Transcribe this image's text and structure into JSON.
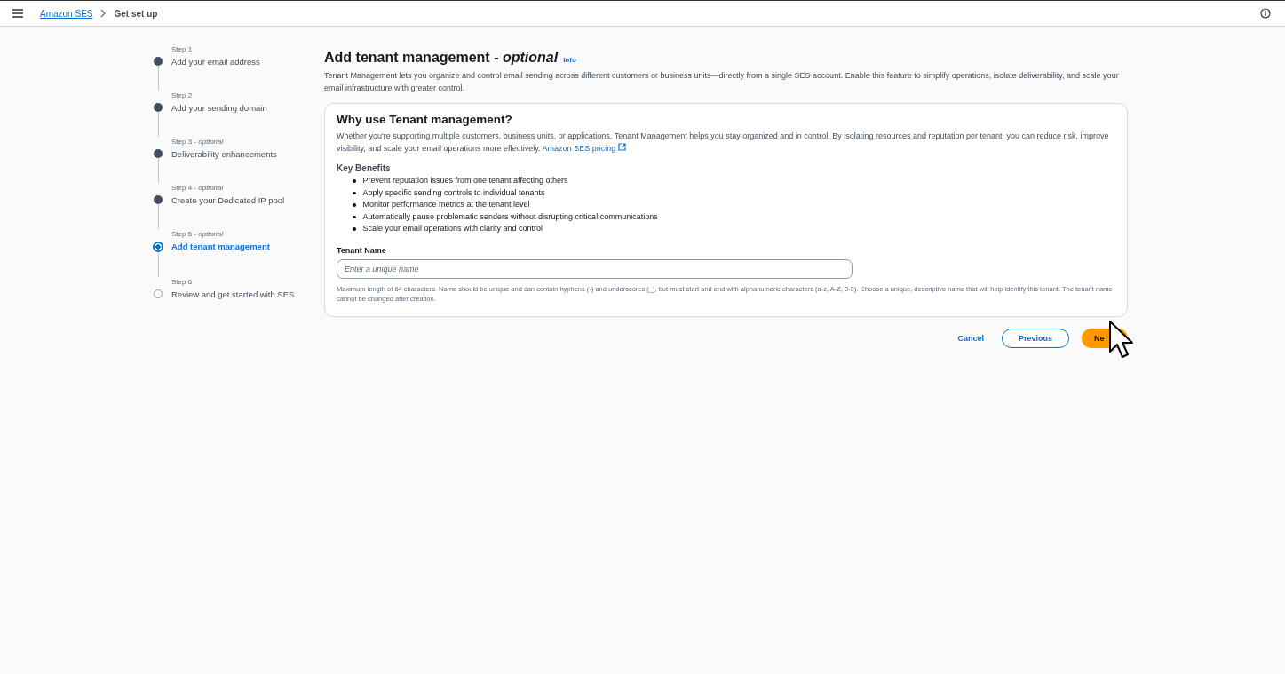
{
  "breadcrumbs": [
    {
      "label": "Amazon SES",
      "link": true
    },
    {
      "label": "Get set up",
      "link": false
    }
  ],
  "steps": [
    {
      "label": "Step 1",
      "title": "Add your email address",
      "kind": "done"
    },
    {
      "label": "Step 2",
      "title": "Add your sending domain",
      "kind": "done"
    },
    {
      "label": "Step 3 - *optional*",
      "title": "Deliverability enhancements",
      "kind": "done"
    },
    {
      "label": "Step 4 - *optional*",
      "title": "Create your Dedicated IP pool",
      "kind": "done"
    },
    {
      "label": "Step 5 - *optional*",
      "title": "Add tenant management",
      "kind": "current"
    },
    {
      "label": "Step 6",
      "title": "Review and get started with SES",
      "kind": "pending"
    }
  ],
  "page": {
    "title": "Add tenant management - *optional*",
    "info": "Info",
    "description": "Tenant Management lets you organize and control email sending across different customers or business units—directly from a single SES account. Enable this feature to simplify operations, isolate deliverability, and scale your email infrastructure with greater control."
  },
  "card": {
    "title": "Why use Tenant management?",
    "text": "Whether you're supporting multiple customers, business units, or applications, Tenant Management helps you stay organized and in control. By isolating resources and reputation per tenant, you can reduce risk, improve visibility, and scale your email operations more effectively.",
    "link": "Amazon SES pricing",
    "benefits_title": "Key Benefits",
    "benefits": [
      "Prevent reputation issues from one tenant affecting others",
      "Apply specific sending controls to individual tenants",
      "Monitor performance metrics at the tenant level",
      "Automatically pause problematic senders without disrupting critical communications",
      "Scale your email operations with clarity and control"
    ],
    "field": {
      "label": "Tenant Name",
      "placeholder": "Enter a unique name",
      "hint": "Maximum length of 64 characters. Name should be unique and can contain hyphens (-) and underscores (_), but must start and end with alphanumeric characters (a-z, A-Z, 0-9). Choose a unique, descriptive name that will help identify this tenant. The tenant name cannot be changed after creation."
    }
  },
  "buttons": [
    {
      "label": "Cancel",
      "kind": "link"
    },
    {
      "label": "Previous",
      "kind": "secondary"
    },
    {
      "label": "Ne",
      "kind": "primary"
    }
  ]
}
